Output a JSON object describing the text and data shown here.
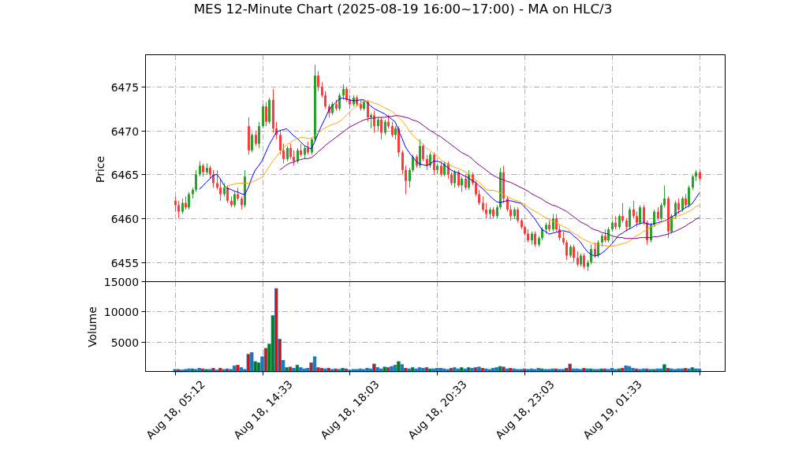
{
  "title": "MES 12-Minute Chart (2025-08-19 16:00~17:00) - MA on HLC/3",
  "price_panel": {
    "chart_data": {
      "type": "candlestick",
      "ylabel": "Price",
      "ylim": [
        6452.83,
        6478.68
      ],
      "yticks": [
        6455,
        6460,
        6465,
        6470,
        6475
      ],
      "grid": true,
      "categories": [
        null,
        null,
        null,
        null,
        null,
        null,
        null,
        null,
        null,
        null,
        null,
        null,
        null,
        null,
        null,
        null,
        null,
        null,
        null,
        null,
        null,
        null,
        null,
        null,
        null,
        null,
        null,
        null,
        null,
        null,
        null,
        null,
        null,
        null,
        null,
        null,
        null,
        null,
        null,
        null,
        null,
        null,
        null,
        null,
        null,
        null,
        null,
        null,
        null,
        null,
        null,
        null,
        null,
        null,
        null,
        null,
        null,
        null,
        null,
        null,
        null,
        null,
        null,
        null,
        null,
        null,
        null,
        null,
        null,
        null,
        null,
        null,
        null,
        null,
        null,
        null,
        null,
        null,
        null,
        null,
        null,
        null,
        null,
        null,
        null,
        null,
        null,
        null,
        null,
        null,
        null,
        null,
        null,
        null,
        null,
        null,
        null,
        null,
        null,
        null,
        null,
        null,
        null,
        null,
        null,
        null,
        null,
        null,
        null,
        null,
        null,
        null,
        null,
        null,
        null,
        null,
        null,
        null,
        null,
        null,
        null,
        null,
        null,
        null,
        null,
        null,
        null,
        null,
        null,
        null,
        null,
        null,
        null,
        null,
        null,
        null,
        null,
        null,
        null,
        null,
        null,
        null,
        null,
        null,
        null,
        null,
        null,
        null,
        null,
        null,
        null,
        null,
        null,
        null,
        null,
        null,
        null,
        null,
        null,
        null,
        null,
        null,
        null,
        null,
        null,
        null
      ],
      "ohlc": [
        null,
        null,
        null,
        null,
        null,
        null,
        null,
        null,
        [
          6462,
          6462.5,
          6460.75,
          6461.5
        ],
        [
          6461.5,
          6462,
          6460,
          6460.75
        ],
        [
          6460.75,
          6462.25,
          6460.5,
          6461.75
        ],
        [
          6461.75,
          6462.5,
          6461,
          6461.25
        ],
        [
          6461.25,
          6463,
          6461,
          6462.75
        ],
        [
          6462.75,
          6463.5,
          6462.25,
          6463.25
        ],
        [
          6463.25,
          6465.5,
          6463,
          6465
        ],
        [
          6465,
          6466.5,
          6464.75,
          6466
        ],
        [
          6466,
          6466.25,
          6464.75,
          6465.25
        ],
        [
          6465.25,
          6466.25,
          6465,
          6465.75
        ],
        [
          6465.75,
          6466,
          6464.5,
          6465
        ],
        [
          6465,
          6465.5,
          6463.5,
          6464
        ],
        [
          6464,
          6465.5,
          6463.25,
          6463.5
        ],
        [
          6463.5,
          6464.5,
          6462,
          6462.75
        ],
        [
          6462.75,
          6464,
          6462.5,
          6463.5
        ],
        [
          6463.5,
          6463.75,
          6461.75,
          6462
        ],
        [
          6462,
          6462.5,
          6461.25,
          6461.5
        ],
        [
          6461.5,
          6463,
          6461.25,
          6462.75
        ],
        [
          6462.75,
          6463.5,
          6462,
          6462.25
        ],
        [
          6462.25,
          6462.5,
          6461,
          6461.5
        ],
        [
          6461.5,
          6465.5,
          6461.25,
          6464.75
        ],
        [
          6470.5,
          6471.5,
          6467.25,
          6467.75
        ],
        [
          6467.75,
          6469.75,
          6467.5,
          6469.5
        ],
        [
          6469.5,
          6470,
          6468.25,
          6468.5
        ],
        [
          6468.5,
          6471,
          6468,
          6470.5
        ],
        [
          6470.5,
          6473,
          6470.25,
          6472.75
        ],
        [
          6472.75,
          6473.25,
          6470.5,
          6471
        ],
        [
          6471,
          6473.75,
          6470.75,
          6473.5
        ],
        [
          6473.5,
          6474.75,
          6469.75,
          6470.25
        ],
        [
          6470.25,
          6471,
          6469,
          6469.5
        ],
        [
          6469.5,
          6470,
          6467.25,
          6467.75
        ],
        [
          6467.75,
          6468.5,
          6466.25,
          6466.75
        ],
        [
          6466.75,
          6468.25,
          6466.5,
          6468
        ],
        [
          6468,
          6468.5,
          6466.75,
          6467
        ],
        [
          6467,
          6467.75,
          6466,
          6466.5
        ],
        [
          6466.5,
          6468,
          6466.25,
          6467.75
        ],
        [
          6467.75,
          6468.5,
          6467,
          6467.25
        ],
        [
          6467.25,
          6468.25,
          6466.75,
          6468
        ],
        [
          6468,
          6468.75,
          6467.25,
          6467.5
        ],
        [
          6467.5,
          6469.25,
          6467.25,
          6469
        ],
        [
          6469,
          6477.5,
          6468.75,
          6476.25
        ],
        [
          6476.25,
          6476.75,
          6474.5,
          6475
        ],
        [
          6475,
          6475.5,
          6473.75,
          6474
        ],
        [
          6474,
          6474.5,
          6472.5,
          6472.75
        ],
        [
          6472.75,
          6473,
          6471.5,
          6472
        ],
        [
          6472,
          6473.25,
          6471.75,
          6473
        ],
        [
          6473,
          6473.5,
          6472.25,
          6472.5
        ],
        [
          6472.5,
          6474.25,
          6472.25,
          6474
        ],
        [
          6474,
          6475.25,
          6473.5,
          6474.75
        ],
        [
          6474.75,
          6475,
          6473.25,
          6473.5
        ],
        [
          6473.5,
          6474,
          6472.5,
          6473
        ],
        [
          6473,
          6474,
          6472.75,
          6473.75
        ],
        [
          6473.75,
          6474,
          6472.75,
          6473
        ],
        [
          6473,
          6473.5,
          6472.25,
          6472.5
        ],
        [
          6472.5,
          6473.5,
          6472.25,
          6473.25
        ],
        [
          6473.25,
          6473.5,
          6471,
          6471.5
        ],
        [
          6471.5,
          6472,
          6470.25,
          6471.75
        ],
        [
          6471.75,
          6472.25,
          6469.75,
          6470.5
        ],
        [
          6470.5,
          6471.5,
          6470,
          6471.25
        ],
        [
          6471.25,
          6471.5,
          6469,
          6469.75
        ],
        [
          6469.75,
          6471.25,
          6469.5,
          6471
        ],
        [
          6471,
          6471.75,
          6470.25,
          6470.5
        ],
        [
          6470.5,
          6471,
          6469.25,
          6469.5
        ],
        [
          6469.5,
          6470.5,
          6469,
          6470.25
        ],
        [
          6470.25,
          6470.5,
          6467,
          6467.5
        ],
        [
          6467.5,
          6467.75,
          6465,
          6465.5
        ],
        [
          6465.5,
          6466,
          6462.75,
          6464.25
        ],
        [
          6464.25,
          6465.75,
          6463.5,
          6465.5
        ],
        [
          6465.5,
          6467.25,
          6465.25,
          6467
        ],
        [
          6467,
          6467.25,
          6465.75,
          6466
        ],
        [
          6466,
          6469,
          6465.75,
          6468.25
        ],
        [
          6468.25,
          6468.5,
          6466.5,
          6466.75
        ],
        [
          6466.75,
          6467.25,
          6465.5,
          6466
        ],
        [
          6466,
          6467.5,
          6465.75,
          6467.25
        ],
        [
          6467.25,
          6467.5,
          6465,
          6465.5
        ],
        [
          6465.5,
          6466.25,
          6465,
          6466
        ],
        [
          6466,
          6466.5,
          6464.75,
          6465
        ],
        [
          6465,
          6466.5,
          6464.75,
          6466.25
        ],
        [
          6466.25,
          6466.5,
          6464.5,
          6465
        ],
        [
          6465,
          6465.25,
          6463.75,
          6464
        ],
        [
          6464,
          6465.5,
          6463.5,
          6465.25
        ],
        [
          6465.25,
          6465.5,
          6463.5,
          6463.75
        ],
        [
          6463.75,
          6464.75,
          6463,
          6464.5
        ],
        [
          6464.5,
          6465,
          6463.25,
          6463.5
        ],
        [
          6463.5,
          6465.5,
          6463.25,
          6465
        ],
        [
          6465,
          6465.25,
          6463.75,
          6464
        ],
        [
          6464,
          6464.25,
          6462.5,
          6462.75
        ],
        [
          6462.75,
          6463.25,
          6461.5,
          6461.75
        ],
        [
          6461.75,
          6462.5,
          6460.75,
          6461
        ],
        [
          6461,
          6461.75,
          6460,
          6460.5
        ],
        [
          6460.5,
          6461.25,
          6460,
          6461
        ],
        [
          6461,
          6461.25,
          6460,
          6460.25
        ],
        [
          6460.25,
          6461.5,
          6460,
          6461.25
        ],
        [
          6461.25,
          6465.75,
          6461,
          6465.25
        ],
        [
          6465.25,
          6466,
          6461.75,
          6462.25
        ],
        [
          6462.25,
          6462.5,
          6460.75,
          6461
        ],
        [
          6461,
          6461.5,
          6459.75,
          6460.25
        ],
        [
          6460.25,
          6461.25,
          6460,
          6461
        ],
        [
          6461,
          6461.25,
          6459.5,
          6459.75
        ],
        [
          6459.75,
          6460,
          6458.75,
          6459
        ],
        [
          6459,
          6459.25,
          6458,
          6458.25
        ],
        [
          6458.25,
          6458.75,
          6457.25,
          6457.5
        ],
        [
          6457.5,
          6458.5,
          6457,
          6458.25
        ],
        [
          6458.25,
          6458.5,
          6456.75,
          6457
        ],
        [
          6457,
          6458,
          6456.75,
          6457.75
        ],
        [
          6457.75,
          6459,
          6457.5,
          6458.75
        ],
        [
          6458.75,
          6459.5,
          6458.25,
          6459.25
        ],
        [
          6459.25,
          6459.75,
          6458.5,
          6458.75
        ],
        [
          6458.75,
          6460.5,
          6458.5,
          6460
        ],
        [
          6460,
          6460.5,
          6458.5,
          6458.75
        ],
        [
          6458.75,
          6459.25,
          6457.5,
          6457.75
        ],
        [
          6457.75,
          6458.5,
          6457,
          6457.25
        ],
        [
          6457.25,
          6457.5,
          6455.25,
          6455.75
        ],
        [
          6455.75,
          6457,
          6455.5,
          6456.75
        ],
        [
          6456.75,
          6457,
          6455,
          6455.5
        ],
        [
          6455.5,
          6456.25,
          6454.5,
          6454.75
        ],
        [
          6454.75,
          6456,
          6454.5,
          6455.75
        ],
        [
          6455.75,
          6456,
          6454.25,
          6454.5
        ],
        [
          6454.5,
          6455.25,
          6454,
          6455
        ],
        [
          6455,
          6457,
          6454.75,
          6456.5
        ],
        [
          6456.5,
          6457.25,
          6455.5,
          6455.75
        ],
        [
          6455.75,
          6457.5,
          6455.5,
          6457.25
        ],
        [
          6457.25,
          6458.25,
          6456.75,
          6458
        ],
        [
          6458,
          6458.75,
          6457.25,
          6457.5
        ],
        [
          6457.5,
          6459,
          6457.25,
          6458.75
        ],
        [
          6458.75,
          6459.75,
          6458.5,
          6459.5
        ],
        [
          6459.5,
          6460.25,
          6458.75,
          6459
        ],
        [
          6459,
          6460.5,
          6458.75,
          6460.25
        ],
        [
          6460.25,
          6461.75,
          6459.5,
          6459.75
        ],
        [
          6459.75,
          6460,
          6458.5,
          6459
        ],
        [
          6459,
          6461.25,
          6458.75,
          6461
        ],
        [
          6461,
          6462,
          6460,
          6460.25
        ],
        [
          6460.25,
          6460.75,
          6459,
          6459.5
        ],
        [
          6459.5,
          6461.5,
          6459.25,
          6461.25
        ],
        [
          6461.25,
          6461.5,
          6459.25,
          6459.5
        ],
        [
          6459.5,
          6459.75,
          6457,
          6457.5
        ],
        [
          6457.5,
          6459.5,
          6457.25,
          6459.25
        ],
        [
          6459.25,
          6461,
          6459,
          6460.75
        ],
        [
          6460.75,
          6461.25,
          6459.75,
          6460
        ],
        [
          6460,
          6461.75,
          6459.75,
          6461.5
        ],
        [
          6461.5,
          6463.75,
          6461.25,
          6462.25
        ],
        [
          6462.25,
          6462.5,
          6457.75,
          6458.5
        ],
        [
          6458.5,
          6460.5,
          6458.25,
          6460.25
        ],
        [
          6460.25,
          6462,
          6460,
          6461.75
        ],
        [
          6461.75,
          6462.25,
          6460.5,
          6461
        ],
        [
          6461,
          6462.5,
          6460.75,
          6462.25
        ],
        [
          6462.25,
          6462.75,
          6461.25,
          6461.5
        ],
        [
          6461.5,
          6463.75,
          6461.25,
          6463.5
        ],
        [
          6463.5,
          6465,
          6463.25,
          6464.75
        ],
        [
          6464.75,
          6465.5,
          6464.25,
          6465.25
        ],
        [
          6465.25,
          6465.5,
          6464.25,
          6464.5
        ],
        null,
        null,
        null,
        null,
        null,
        null,
        null
      ],
      "series": [
        {
          "type": "line",
          "color": "#0000ff",
          "values": [
            null,
            null,
            null,
            null,
            null,
            null,
            null,
            null,
            null,
            null,
            null,
            null,
            null,
            null,
            null,
            6463.3,
            6463.7,
            6464.1,
            6464.5,
            6464.9,
            6465.0,
            6464.5,
            6463.8,
            6463.4,
            6463.3,
            6463.1,
            6463.0,
            6462.8,
            6462.7,
            6463.5,
            6464.6,
            6465.5,
            6466.0,
            6466.6,
            6467.5,
            6468.4,
            6469.1,
            6469.8,
            6470.0,
            6470.1,
            6470.2,
            6469.8,
            6469.4,
            6469.1,
            6468.7,
            6468.3,
            6468.1,
            6467.9,
            6468.7,
            6469.7,
            6470.6,
            6471.4,
            6472.3,
            6472.8,
            6473.2,
            6473.6,
            6473.7,
            6473.6,
            6473.5,
            6473.4,
            6473.4,
            6473.5,
            6473.5,
            6473.2,
            6472.8,
            6472.5,
            6472.3,
            6472.1,
            6471.9,
            6471.6,
            6471.3,
            6471.0,
            6470.0,
            6469.1,
            6468.1,
            6467.5,
            6467.0,
            6466.5,
            6466.2,
            6466.1,
            6466.0,
            6466.2,
            6466.5,
            6466.5,
            6466.4,
            6466.1,
            6465.8,
            6465.5,
            6465.3,
            6465.2,
            6465.0,
            6464.8,
            6464.6,
            6464.3,
            6464.1,
            6463.7,
            6463.4,
            6463.0,
            6462.6,
            6462.2,
            6461.9,
            6461.8,
            6461.9,
            6462.0,
            6462.0,
            6461.9,
            6461.8,
            6461.7,
            6461.3,
            6460.9,
            6460.4,
            6459.9,
            6459.3,
            6458.7,
            6458.5,
            6458.2,
            6458.3,
            6458.4,
            6458.5,
            6458.6,
            6458.5,
            6458.4,
            6458.0,
            6457.7,
            6457.3,
            6456.7,
            6456.2,
            6455.9,
            6455.7,
            6455.8,
            6456.0,
            6456.3,
            6456.7,
            6457.1,
            6457.6,
            6458.1,
            6458.3,
            6458.6,
            6458.8,
            6459.0,
            6459.3,
            6459.4,
            6459.5,
            6459.4,
            6459.3,
            6459.4,
            6459.5,
            6459.6,
            6459.7,
            6459.9,
            6460.1,
            6460.4,
            6460.7,
            6460.9,
            6461.2,
            6461.4,
            6461.7,
            6462.3,
            6462.9,
            null,
            null,
            null,
            null,
            null,
            null,
            null
          ]
        },
        {
          "type": "line",
          "color": "#ffa500",
          "values": [
            null,
            null,
            null,
            null,
            null,
            null,
            null,
            null,
            null,
            null,
            null,
            null,
            null,
            null,
            null,
            null,
            null,
            null,
            null,
            null,
            null,
            null,
            null,
            6463.7,
            6463.8,
            6463.9,
            6464.0,
            6464.0,
            6464.0,
            6464.0,
            6464.1,
            6464.3,
            6464.5,
            6464.7,
            6465.3,
            6465.9,
            6466.5,
            6467.0,
            6467.5,
            6468.0,
            6468.4,
            6468.6,
            6468.9,
            6469.1,
            6469.2,
            6469.2,
            6469.1,
            6469.1,
            6469.4,
            6469.7,
            6470.1,
            6470.3,
            6470.5,
            6470.7,
            6470.8,
            6471.0,
            6471.3,
            6471.7,
            6472.1,
            6472.5,
            6472.8,
            6473.1,
            6473.4,
            6473.4,
            6473.3,
            6473.1,
            6473.0,
            6472.8,
            6472.6,
            6472.4,
            6472.2,
            6471.9,
            6471.5,
            6471.1,
            6470.6,
            6470.0,
            6469.5,
            6469.1,
            6468.8,
            6468.4,
            6468.0,
            6467.7,
            6467.4,
            6467.1,
            6466.7,
            6466.4,
            6466.2,
            6466.0,
            6465.8,
            6465.7,
            6465.5,
            6465.3,
            6465.0,
            6464.7,
            6464.4,
            6464.1,
            6463.7,
            6463.3,
            6463.2,
            6463.2,
            6463.1,
            6462.9,
            6462.7,
            6462.5,
            6462.3,
            6462.1,
            6462.0,
            6461.8,
            6461.6,
            6461.3,
            6461.0,
            6460.8,
            6460.6,
            6460.3,
            6460.1,
            6459.9,
            6459.7,
            6459.5,
            6459.3,
            6459.1,
            6458.9,
            6458.6,
            6458.3,
            6458.1,
            6457.8,
            6457.6,
            6457.4,
            6457.2,
            6457.1,
            6457.0,
            6456.9,
            6456.9,
            6456.8,
            6456.8,
            6456.9,
            6457.0,
            6457.1,
            6457.2,
            6457.4,
            6457.7,
            6458.0,
            6458.2,
            6458.5,
            6458.7,
            6459.0,
            6459.1,
            6459.3,
            6459.5,
            6459.7,
            6459.8,
            6460.0,
            6460.1,
            6460.3,
            6460.4,
            6460.6,
            6460.8,
            6461.0,
            6461.3,
            6461.5,
            null,
            null,
            null,
            null,
            null,
            null,
            null
          ]
        },
        {
          "type": "line",
          "color": "#800080",
          "values": [
            null,
            null,
            null,
            null,
            null,
            null,
            null,
            null,
            null,
            null,
            null,
            null,
            null,
            null,
            null,
            null,
            null,
            null,
            null,
            null,
            null,
            null,
            null,
            null,
            null,
            null,
            null,
            null,
            null,
            null,
            null,
            null,
            null,
            null,
            null,
            null,
            null,
            null,
            6465.5,
            6465.8,
            6466.1,
            6466.3,
            6466.4,
            6466.6,
            6466.7,
            6466.8,
            6466.8,
            6466.9,
            6467.2,
            6467.6,
            6467.9,
            6468.3,
            6468.6,
            6468.9,
            6469.2,
            6469.5,
            6469.8,
            6470.1,
            6470.4,
            6470.6,
            6470.8,
            6471.0,
            6471.2,
            6471.3,
            6471.4,
            6471.4,
            6471.5,
            6471.5,
            6471.5,
            6471.6,
            6471.6,
            6471.7,
            6471.7,
            6471.6,
            6471.5,
            6471.4,
            6471.2,
            6471.1,
            6470.9,
            6470.6,
            6470.3,
            6470.0,
            6469.8,
            6469.5,
            6469.3,
            6469.0,
            6468.7,
            6468.4,
            6468.1,
            6467.8,
            6467.5,
            6467.3,
            6467.1,
            6466.8,
            6466.4,
            6466.1,
            6465.8,
            6465.5,
            6465.2,
            6464.9,
            6464.7,
            6464.5,
            6464.4,
            6464.2,
            6464.1,
            6463.9,
            6463.7,
            6463.5,
            6463.3,
            6463.1,
            6462.8,
            6462.6,
            6462.4,
            6462.2,
            6461.9,
            6461.7,
            6461.5,
            6461.4,
            6461.2,
            6461.0,
            6460.8,
            6460.5,
            6460.2,
            6459.9,
            6459.6,
            6459.4,
            6459.2,
            6458.9,
            6458.7,
            6458.6,
            6458.4,
            6458.3,
            6458.2,
            6458.0,
            6457.9,
            6457.8,
            6457.8,
            6457.7,
            6457.7,
            6457.7,
            6457.7,
            6457.8,
            6457.8,
            6457.8,
            6457.8,
            6457.9,
            6457.9,
            6458.0,
            6458.1,
            6458.2,
            6458.4,
            6458.5,
            6458.7,
            6458.9,
            6459.1,
            6459.4,
            6459.6,
            6459.9,
            6460.1,
            null,
            null,
            null,
            null,
            null,
            null,
            null
          ]
        }
      ]
    }
  },
  "volume_panel": {
    "chart_data": {
      "type": "bar",
      "ylabel": "Volume",
      "ylim": [
        0,
        15000
      ],
      "yticks": [
        5000,
        10000,
        15000
      ],
      "grid": true,
      "categories": [
        null,
        null,
        null,
        null,
        null,
        null,
        null,
        null,
        "Aug 18, 05:12",
        null,
        null,
        null,
        null,
        null,
        null,
        null,
        null,
        null,
        null,
        null,
        null,
        null,
        null,
        null,
        null,
        null,
        null,
        null,
        null,
        null,
        null,
        null,
        null,
        "Aug 18, 14:33",
        null,
        null,
        null,
        null,
        null,
        null,
        null,
        null,
        null,
        null,
        null,
        null,
        null,
        null,
        null,
        null,
        null,
        null,
        null,
        null,
        null,
        null,
        null,
        null,
        "Aug 18, 18:03",
        null,
        null,
        null,
        null,
        null,
        null,
        null,
        null,
        null,
        null,
        null,
        null,
        null,
        null,
        null,
        null,
        null,
        null,
        null,
        null,
        null,
        null,
        null,
        null,
        "Aug 18, 20:33",
        null,
        null,
        null,
        null,
        null,
        null,
        null,
        null,
        null,
        null,
        null,
        null,
        null,
        null,
        null,
        null,
        null,
        null,
        null,
        null,
        null,
        null,
        null,
        null,
        "Aug 18, 23:03",
        null,
        null,
        null,
        null,
        null,
        null,
        null,
        null,
        null,
        null,
        null,
        null,
        null,
        null,
        null,
        null,
        null,
        null,
        null,
        null,
        null,
        null,
        null,
        null,
        "Aug 19, 01:33",
        null,
        null,
        null,
        null,
        null,
        null,
        null,
        null,
        null,
        null,
        null,
        null,
        null,
        null,
        null,
        null,
        null,
        null,
        null,
        null,
        null,
        null,
        null,
        null,
        null,
        null,
        null,
        null,
        null,
        null,
        null,
        null
      ],
      "series": [
        {
          "color": "#1f77b4",
          "values": [
            null,
            null,
            null,
            null,
            null,
            null,
            null,
            null,
            400,
            null,
            300,
            400,
            500,
            null,
            400,
            600,
            null,
            null,
            400,
            null,
            300,
            null,
            400,
            null,
            400,
            1000,
            null,
            700,
            400,
            null,
            3200,
            null,
            null,
            2500,
            null,
            null,
            null,
            null,
            null,
            1900,
            null,
            null,
            600,
            null,
            700,
            500,
            600,
            null,
            2500,
            null,
            null,
            500,
            null,
            400,
            null,
            400,
            null,
            null,
            300,
            400,
            400,
            500,
            400,
            600,
            500,
            null,
            700,
            500,
            null,
            null,
            900,
            1100,
            null,
            1200,
            null,
            500,
            null,
            500,
            700,
            600,
            null,
            null,
            500,
            600,
            600,
            500,
            400,
            null,
            700,
            500,
            null,
            500,
            null,
            600,
            null,
            800,
            null,
            500,
            400,
            600,
            700,
            null,
            null,
            500,
            null,
            500,
            400,
            400,
            null,
            400,
            500,
            400,
            600,
            null,
            400,
            400,
            500,
            null,
            400,
            400,
            null,
            null,
            500,
            500,
            400,
            null,
            500,
            null,
            400,
            400,
            null,
            null,
            400,
            600,
            400,
            null,
            null,
            1000,
            900,
            600,
            null,
            400,
            500,
            null,
            400,
            null,
            500,
            500,
            null,
            null,
            500,
            400,
            500,
            500,
            null,
            500,
            null,
            500,
            500,
            null,
            null,
            null,
            null,
            null,
            null,
            null
          ]
        },
        {
          "color": "#ff0000",
          "values": [
            null,
            null,
            null,
            null,
            null,
            null,
            null,
            null,
            null,
            400,
            null,
            null,
            null,
            null,
            null,
            null,
            500,
            null,
            null,
            600,
            null,
            600,
            null,
            500,
            null,
            null,
            1100,
            null,
            null,
            2900,
            null,
            null,
            null,
            null,
            3900,
            null,
            null,
            13800,
            5400,
            null,
            null,
            800,
            null,
            null,
            null,
            null,
            null,
            1500,
            null,
            700,
            600,
            null,
            600,
            null,
            500,
            null,
            null,
            500,
            null,
            null,
            null,
            null,
            null,
            null,
            null,
            1300,
            null,
            null,
            null,
            700,
            null,
            null,
            null,
            null,
            600,
            null,
            null,
            null,
            null,
            null,
            700,
            null,
            null,
            null,
            null,
            null,
            null,
            600,
            null,
            null,
            null,
            null,
            null,
            null,
            700,
            null,
            600,
            null,
            null,
            null,
            null,
            null,
            800,
            null,
            600,
            null,
            null,
            null,
            500,
            null,
            null,
            null,
            null,
            null,
            null,
            null,
            null,
            500,
            null,
            null,
            600,
            1300,
            null,
            null,
            null,
            600,
            null,
            null,
            null,
            null,
            null,
            500,
            null,
            null,
            null,
            null,
            600,
            null,
            null,
            null,
            500,
            null,
            null,
            500,
            null,
            null,
            null,
            null,
            null,
            600,
            null,
            null,
            null,
            null,
            600,
            null,
            null,
            null,
            null,
            null,
            null,
            null,
            null,
            null,
            null,
            null
          ]
        },
        {
          "color": "#008000",
          "values": [
            null,
            null,
            null,
            null,
            null,
            null,
            null,
            null,
            null,
            null,
            null,
            null,
            null,
            500,
            null,
            null,
            null,
            400,
            null,
            null,
            null,
            null,
            null,
            null,
            null,
            null,
            null,
            null,
            null,
            null,
            null,
            1700,
            1500,
            null,
            null,
            4600,
            9300,
            null,
            null,
            null,
            700,
            null,
            null,
            1100,
            null,
            null,
            null,
            null,
            null,
            null,
            null,
            null,
            null,
            null,
            null,
            null,
            600,
            null,
            null,
            null,
            null,
            null,
            null,
            null,
            null,
            null,
            null,
            null,
            800,
            null,
            null,
            null,
            1700,
            null,
            null,
            null,
            700,
            null,
            null,
            null,
            null,
            500,
            null,
            null,
            null,
            null,
            null,
            null,
            null,
            null,
            700,
            null,
            700,
            null,
            null,
            null,
            null,
            null,
            null,
            null,
            null,
            900,
            null,
            null,
            null,
            null,
            null,
            null,
            null,
            null,
            null,
            null,
            null,
            500,
            null,
            null,
            null,
            null,
            null,
            null,
            null,
            null,
            null,
            null,
            null,
            null,
            null,
            500,
            null,
            null,
            500,
            null,
            null,
            null,
            null,
            500,
            null,
            null,
            null,
            null,
            null,
            null,
            null,
            null,
            null,
            400,
            null,
            null,
            1200,
            null,
            null,
            null,
            null,
            null,
            null,
            null,
            700,
            null,
            null,
            null,
            null,
            null,
            null,
            null,
            null,
            null
          ]
        }
      ]
    }
  }
}
